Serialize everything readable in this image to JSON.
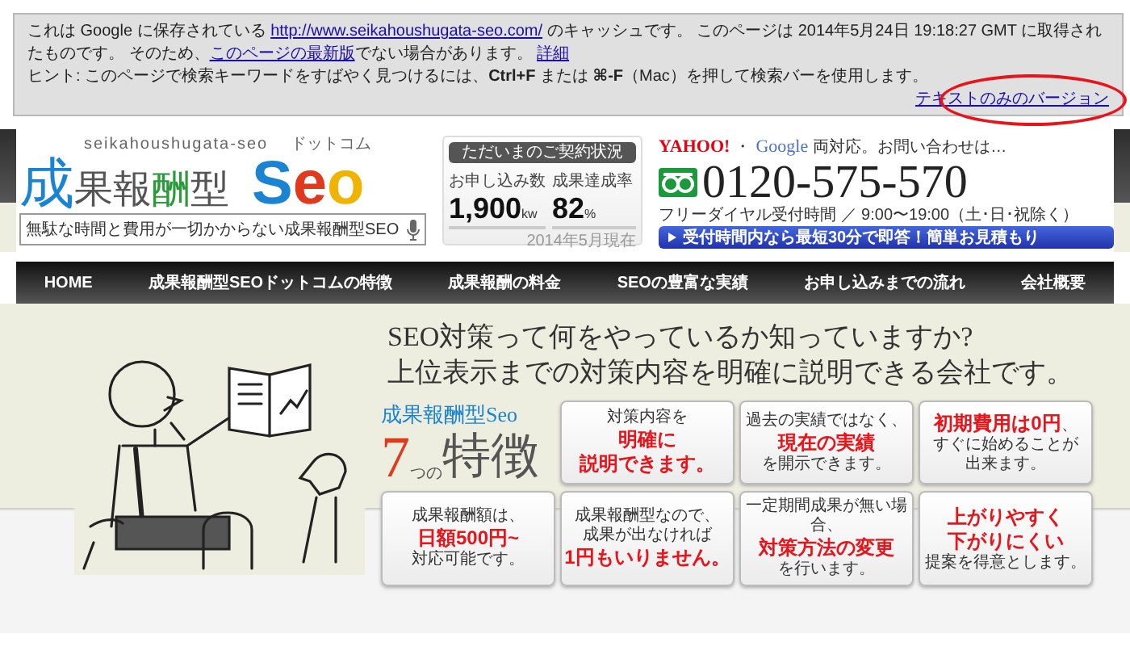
{
  "cache_notice": {
    "paragraph": [
      {
        "kind": "text",
        "text": "これは Google に保存されている "
      },
      {
        "kind": "link",
        "text": "http://www.seikahoushugata-seo.com/"
      },
      {
        "kind": "text",
        "text": " のキャッシュです。 このページは 2014年5月24日 19:18:27 GMT に取得されたものです。 そのため、"
      },
      {
        "kind": "link",
        "text": "このページの最新版"
      },
      {
        "kind": "text",
        "text": "でない場合があります。 "
      },
      {
        "kind": "link",
        "text": "詳細"
      }
    ],
    "hint": "ヒント: このページで検索キーワードをすばやく見つけるには、**Ctrl+F** または **⌘-F**（Mac）を押して検索バーを使用します。",
    "text_only_link": "テキストのみのバージョン"
  },
  "header": {
    "logo": {
      "kicker": "seikahoushugata-seo",
      "suffix": "ドットコム",
      "parts": [
        {
          "text": "成",
          "color": "#1a84d2"
        },
        {
          "text": "果報",
          "color": "#555555"
        },
        {
          "text": "酬",
          "color": "#2a9a3a"
        },
        {
          "text": "型",
          "color": "#555555"
        },
        {
          "text": "S",
          "color": "#1a84d2"
        },
        {
          "text": "e",
          "color": "#e03a1e"
        },
        {
          "text": "o",
          "color": "#f0b400"
        }
      ]
    },
    "search": {
      "value": "無駄な時間と費用が一切かからない成果報酬型SEO"
    },
    "contract": {
      "title": "ただいまのご契約状況",
      "stats": [
        {
          "label": "お申し込み数",
          "value": "1,900",
          "unit": "kw"
        },
        {
          "label": "成果達成率",
          "value": "82",
          "unit": "%"
        }
      ],
      "date": "2014年5月現在"
    },
    "contact": {
      "yahoo": "YAHOO!",
      "separator": "・",
      "google": "Google",
      "lead": "両対応。お問い合わせは…",
      "phone": "0120-575-570",
      "hours": "フリーダイヤル受付時間 ／ 9:00〜19:00（土･日･祝除く）",
      "button": "受付時間内なら最短30分で即答！簡単お見積もり"
    }
  },
  "nav": [
    "HOME",
    "成果報酬型SEOドットコムの特徴",
    "成果報酬の料金",
    "SEOの豊富な実績",
    "お申し込みまでの流れ",
    "会社概要"
  ],
  "hero": {
    "headline": [
      "SEO対策って何をやっているか知っていますか?",
      "上位表示までの対策内容を明確に説明できる会社です。"
    ],
    "features_logo": {
      "brand": "成果報酬型Seo",
      "number": "7",
      "particle": "つの",
      "title": "特徴"
    },
    "cards": [
      {
        "lines": [
          [
            {
              "text": "対策内容を",
              "emphasis": false
            }
          ],
          [
            {
              "text": "明確に",
              "emphasis": true
            }
          ],
          [
            {
              "text": "説明できます。",
              "emphasis": true
            }
          ]
        ]
      },
      {
        "lines": [
          [
            {
              "text": "過去の実績ではなく、",
              "emphasis": false
            }
          ],
          [
            {
              "text": "現在の実績",
              "emphasis": true
            }
          ],
          [
            {
              "text": "を開示できます。",
              "emphasis": false
            }
          ]
        ]
      },
      {
        "lines": [
          [
            {
              "text": "初期費用は0円",
              "emphasis": true
            },
            {
              "text": "、",
              "emphasis": false
            }
          ],
          [
            {
              "text": "すぐに始めることが",
              "emphasis": false
            }
          ],
          [
            {
              "text": "出来ます。",
              "emphasis": false
            }
          ]
        ]
      },
      {
        "lines": [
          [
            {
              "text": "成果報酬額は、",
              "emphasis": false
            }
          ],
          [
            {
              "text": "日額500円~",
              "emphasis": true
            }
          ],
          [
            {
              "text": "対応可能です。",
              "emphasis": false
            }
          ]
        ]
      },
      {
        "lines": [
          [
            {
              "text": "成果報酬型なので、",
              "emphasis": false
            }
          ],
          [
            {
              "text": "成果が出なければ",
              "emphasis": false
            }
          ],
          [
            {
              "text": "1円もいりません。",
              "emphasis": true
            }
          ]
        ]
      },
      {
        "lines": [
          [
            {
              "text": "一定期間成果が無い場合、",
              "emphasis": false
            }
          ],
          [
            {
              "text": "対策方法の変更",
              "emphasis": true
            }
          ],
          [
            {
              "text": "を行います。",
              "emphasis": false
            }
          ]
        ]
      },
      {
        "lines": [
          [
            {
              "text": "上がりやすく",
              "emphasis": true
            }
          ],
          [
            {
              "text": "下がりにくい",
              "emphasis": true
            }
          ],
          [
            {
              "text": "提案を得意とします。",
              "emphasis": false
            }
          ]
        ]
      }
    ]
  }
}
